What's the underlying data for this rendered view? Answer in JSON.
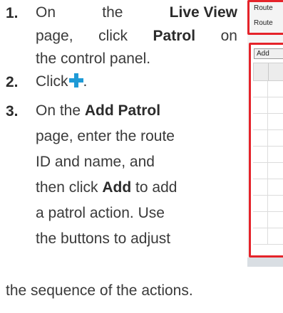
{
  "steps": [
    {
      "number": "1.",
      "lines": [
        [
          "On",
          "the",
          "Live View"
        ],
        [
          "page,",
          "click",
          "Patrol",
          "on"
        ],
        [
          "the control panel."
        ]
      ]
    },
    {
      "number": "2.",
      "text": "Click",
      "icon": "plus-icon",
      "trailing": "."
    },
    {
      "number": "3.",
      "lines": [
        "On the ",
        "Add Patrol",
        "page, enter the route",
        "ID and name, and",
        "then click ",
        "Add",
        " to add",
        "a patrol action. Use",
        "the buttons to adjust",
        "the sequence of the actions."
      ]
    }
  ],
  "screenshot": {
    "route_label_1": "Route",
    "route_label_2": "Route",
    "add_button": "Add",
    "highlight_color": "#e5232a",
    "accent_color": "#1f9ad6"
  }
}
